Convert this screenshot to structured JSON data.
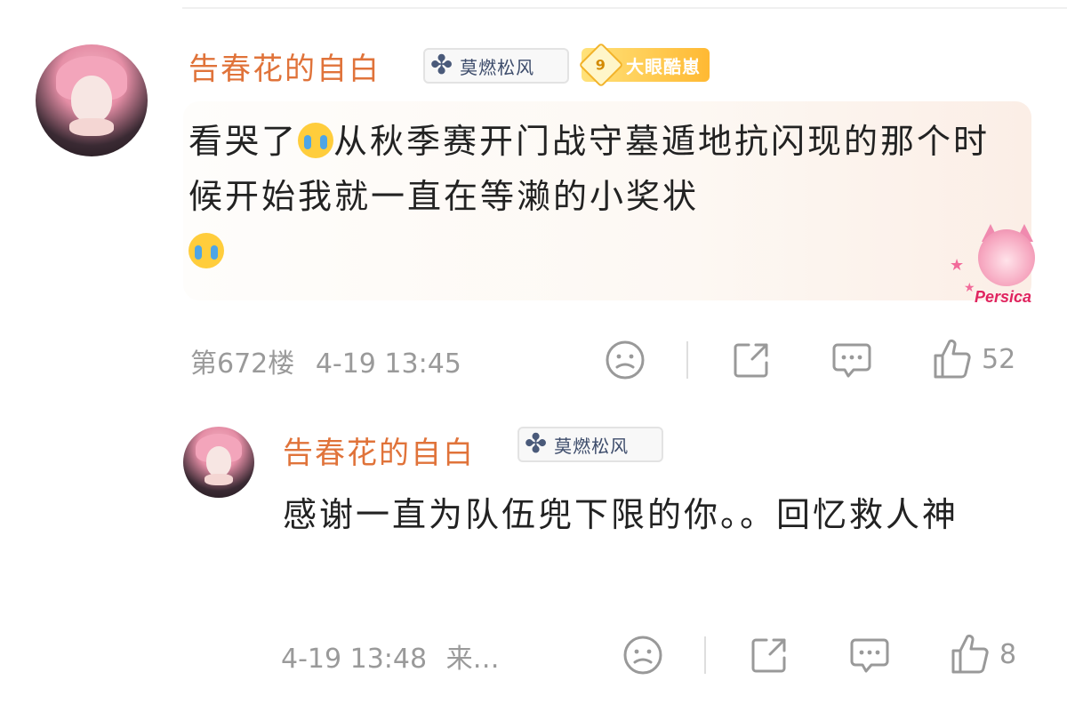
{
  "comment": {
    "username": "告春花的自白",
    "fan_badge": {
      "icon": "clover-icon",
      "label": "莫燃松风"
    },
    "vip_badge": {
      "level": "9",
      "label": "大眼酷崽"
    },
    "text_part1": "看哭了",
    "text_part2": "从秋季赛开门战守墓遁地抗闪现的那个时候开始我就一直在等濑的小奖状",
    "emoji": "crying-face-icon",
    "sticker_brand": "Persica",
    "floor": "第672楼",
    "time": "4-19 13:45",
    "likes": "52"
  },
  "reply": {
    "username": "告春花的自白",
    "fan_badge": {
      "icon": "clover-icon",
      "label": "莫燃松风"
    },
    "text": "感谢一直为队伍兜下限的你。。回忆救人神",
    "time": "4-19 13:48",
    "source": "来…",
    "likes": "8"
  },
  "colors": {
    "username": "#e0733a",
    "meta_gray": "#9a9a9a",
    "vip_gold": "#ffb933",
    "fan_badge_text": "#3d4c6b"
  }
}
